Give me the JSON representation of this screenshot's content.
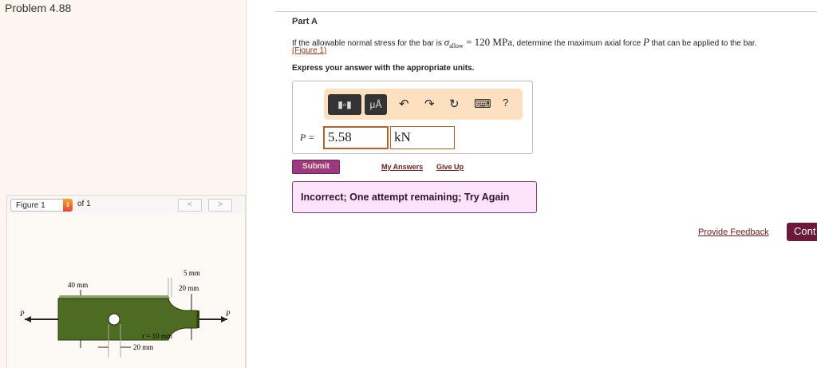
{
  "problem_title": "Problem 4.88",
  "figure": {
    "selector": "Figure 1",
    "of": "of 1",
    "prev": "<",
    "next": ">",
    "labels": {
      "w40": "40 mm",
      "gap5": "5 mm",
      "w20": "20 mm",
      "r": "r = 10 mm",
      "hole20": "20 mm",
      "p_left": "P",
      "p_right": "P"
    }
  },
  "part": {
    "label": "Part A",
    "question_pre": "If the allowable normal stress for the bar is ",
    "sigma": "σ",
    "sigma_sub": "allow",
    "eq": " = 120 MPa",
    "question_mid": ", determine the maximum axial force ",
    "P": "P",
    "question_post": " that can be applied to the bar.",
    "figure_link": "(Figure 1)",
    "instructions": "Express your answer with the appropriate units."
  },
  "toolbar": {
    "templates": "▮▫▮",
    "units": "μÅ",
    "undo": "↶",
    "redo": "↷",
    "reset": "↻",
    "keyboard": "⌨",
    "help": "?"
  },
  "answer": {
    "label": "P =",
    "value": "5.58",
    "unit": "kN"
  },
  "buttons": {
    "submit": "Submit",
    "my_answers": "My Answers",
    "give_up": "Give Up",
    "provide_feedback": "Provide Feedback",
    "continue": "Cont"
  },
  "feedback": "Incorrect; One attempt remaining; Try Again"
}
